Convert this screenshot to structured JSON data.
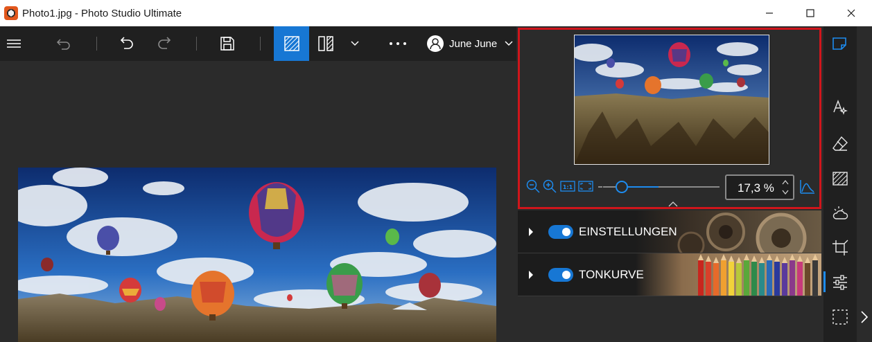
{
  "window": {
    "title": "Photo1.jpg - Photo Studio Ultimate",
    "controls": [
      "minimize",
      "maximize",
      "close"
    ]
  },
  "toolbar": {
    "user_name": "June June",
    "items": [
      "menu-icon",
      "revert-icon",
      "undo-icon",
      "redo-icon",
      "save-icon",
      "single-view-icon",
      "split-view-icon",
      "chevron-down-icon",
      "more-icon"
    ],
    "active_item": "single-view-icon",
    "accent_color": "#1777d4"
  },
  "navigator": {
    "zoom_value": "17,3 %",
    "zoom_buttons": [
      "zoom-out-icon",
      "zoom-in-icon",
      "actual-size-icon",
      "fit-screen-icon"
    ],
    "zoom_buttons_fit_label": "1:1",
    "slider_level": 0.42,
    "highlight_color": "#d0151b"
  },
  "sections": [
    {
      "label": "EINSTELLUNGEN",
      "enabled": true
    },
    {
      "label": "TONKURVE",
      "enabled": true
    }
  ],
  "sidebar": {
    "icons": [
      "edit-icon",
      "effects-icon",
      "eraser-icon",
      "frames-icon",
      "weather-icon",
      "crop-icon",
      "adjustments-icon",
      "selection-icon"
    ],
    "active_icon": "adjustments-icon"
  }
}
